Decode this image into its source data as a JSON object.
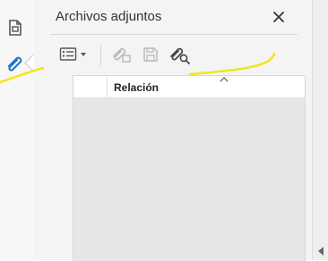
{
  "panel": {
    "title": "Archivos adjuntos",
    "column_header": "Relación"
  },
  "icons": {
    "rail": [
      "document-icon",
      "paperclip-icon"
    ],
    "toolbar": [
      "list-options-icon",
      "chevron-down-icon",
      "add-attachment-icon",
      "save-icon",
      "search-attachment-icon"
    ],
    "panel": [
      "close-icon",
      "sort-caret-icon",
      "scroll-left-arrow-icon"
    ]
  },
  "colors": {
    "accent": "#1a73c8",
    "annotation": "#f2e61c",
    "panel_bg": "#f4f4f4",
    "list_bg": "#e6e6e6"
  }
}
